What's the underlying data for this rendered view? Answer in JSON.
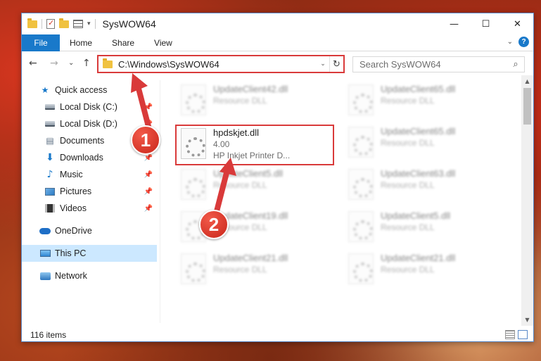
{
  "window": {
    "title": "SysWOW64",
    "controls": {
      "minimize": "—",
      "maximize": "☐",
      "close": "✕"
    }
  },
  "ribbon": {
    "tabs": [
      {
        "label": "File"
      },
      {
        "label": "Home"
      },
      {
        "label": "Share"
      },
      {
        "label": "View"
      }
    ],
    "help": "?"
  },
  "navigation": {
    "back": "←",
    "forward": "→",
    "recent": "⌄",
    "up": "↑",
    "address": "C:\\Windows\\SysWOW64",
    "search_placeholder": "Search SysWOW64"
  },
  "sidebar": {
    "items": [
      {
        "label": "Quick access",
        "icon": "star-icon"
      },
      {
        "label": "Local Disk (C:)",
        "icon": "drive-icon",
        "pinned": true
      },
      {
        "label": "Local Disk (D:)",
        "icon": "drive-icon",
        "pinned": true
      },
      {
        "label": "Documents",
        "icon": "documents-icon",
        "pinned": true
      },
      {
        "label": "Downloads",
        "icon": "download-icon",
        "pinned": true
      },
      {
        "label": "Music",
        "icon": "music-icon",
        "pinned": true
      },
      {
        "label": "Pictures",
        "icon": "pictures-icon",
        "pinned": true
      },
      {
        "label": "Videos",
        "icon": "videos-icon",
        "pinned": true
      },
      {
        "label": "OneDrive",
        "icon": "cloud-icon"
      },
      {
        "label": "This PC",
        "icon": "computer-icon",
        "selected": true
      },
      {
        "label": "Network",
        "icon": "network-icon"
      }
    ]
  },
  "files": {
    "left": [
      {
        "name": "UpdateClient42.dll",
        "meta": "Resource DLL",
        "blurred": true
      },
      {
        "name": "hpdskjet.dll",
        "version": "4.00",
        "meta": "HP Inkjet Printer D...",
        "highlighted": true
      },
      {
        "name": "UpdateClient5.dll",
        "meta": "Resource DLL",
        "blurred": true
      },
      {
        "name": "UpdateClient19.dll",
        "meta": "Resource DLL",
        "blurred": true
      },
      {
        "name": "UpdateClient21.dll",
        "meta": "Resource DLL",
        "blurred": true
      }
    ],
    "right": [
      {
        "name": "UpdateClient65.dll",
        "meta": "Resource DLL",
        "blurred": true
      },
      {
        "name": "UpdateClient65.dll",
        "meta": "Resource DLL",
        "blurred": true
      },
      {
        "name": "UpdateClient63.dll",
        "meta": "Resource DLL",
        "blurred": true
      },
      {
        "name": "UpdateClient5.dll",
        "meta": "Resource DLL",
        "blurred": true
      },
      {
        "name": "UpdateClient21.dll",
        "meta": "Resource DLL",
        "blurred": true
      }
    ]
  },
  "status": {
    "item_count": "116 items"
  },
  "annotations": {
    "step1": "1",
    "step2": "2",
    "color": "#d93a3a"
  }
}
